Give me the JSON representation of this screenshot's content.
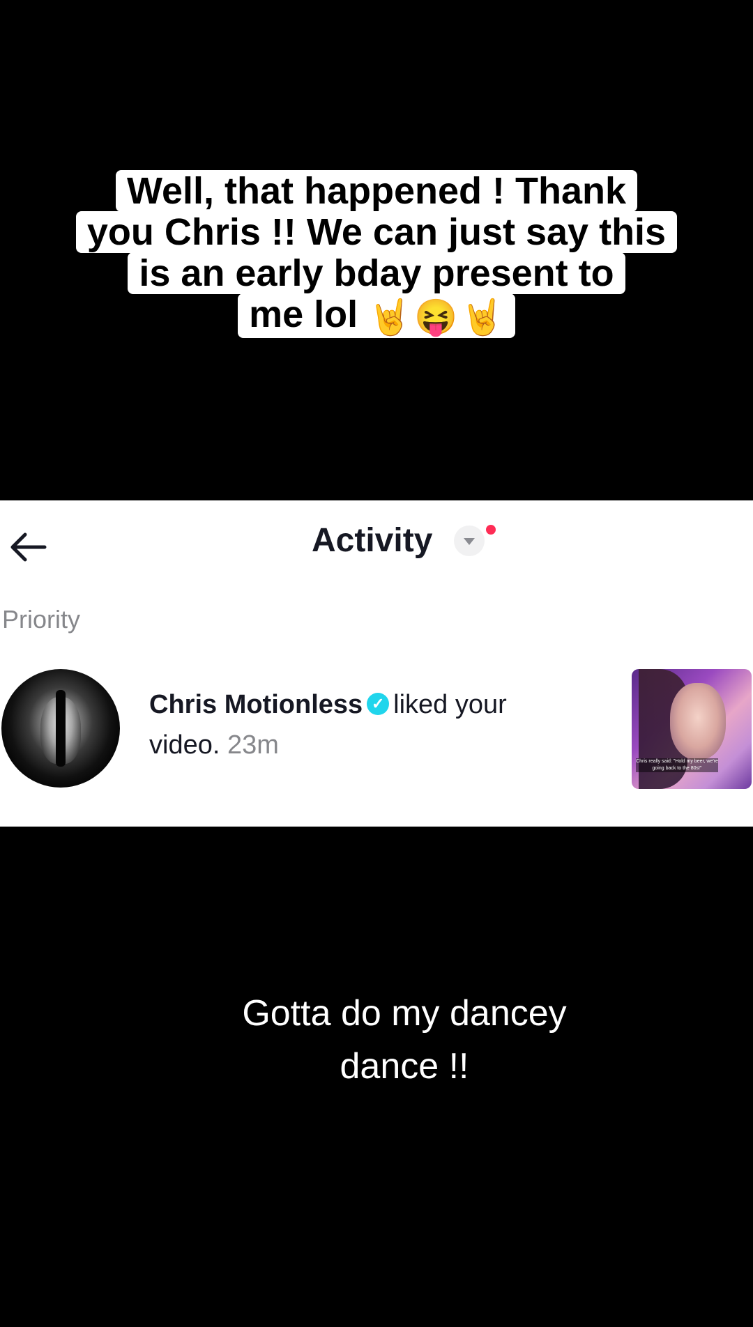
{
  "top_caption": {
    "line1": "Well, that happened ! Thank",
    "line2": "you Chris !!  We can just say this",
    "line3": "is an early bday present to",
    "line4": "me lol",
    "emojis": [
      "🤘",
      "😝",
      "🤘"
    ]
  },
  "activity_panel": {
    "title": "Activity",
    "section_label": "Priority",
    "notification": {
      "user_name": "Chris Motionless",
      "verified_mark": "✓",
      "action_text": "liked your",
      "action_text_2": "video.",
      "time": "23m",
      "thumbnail_caption": "Chris really said: \"Hold my beer, we're going back to the 80s!\""
    },
    "colors": {
      "accent_dot": "#fe2c55",
      "verified": "#20d5ec",
      "muted_text": "#86878b"
    }
  },
  "bottom_caption": {
    "line1": "Gotta do my dancey",
    "line2": "dance !!"
  }
}
